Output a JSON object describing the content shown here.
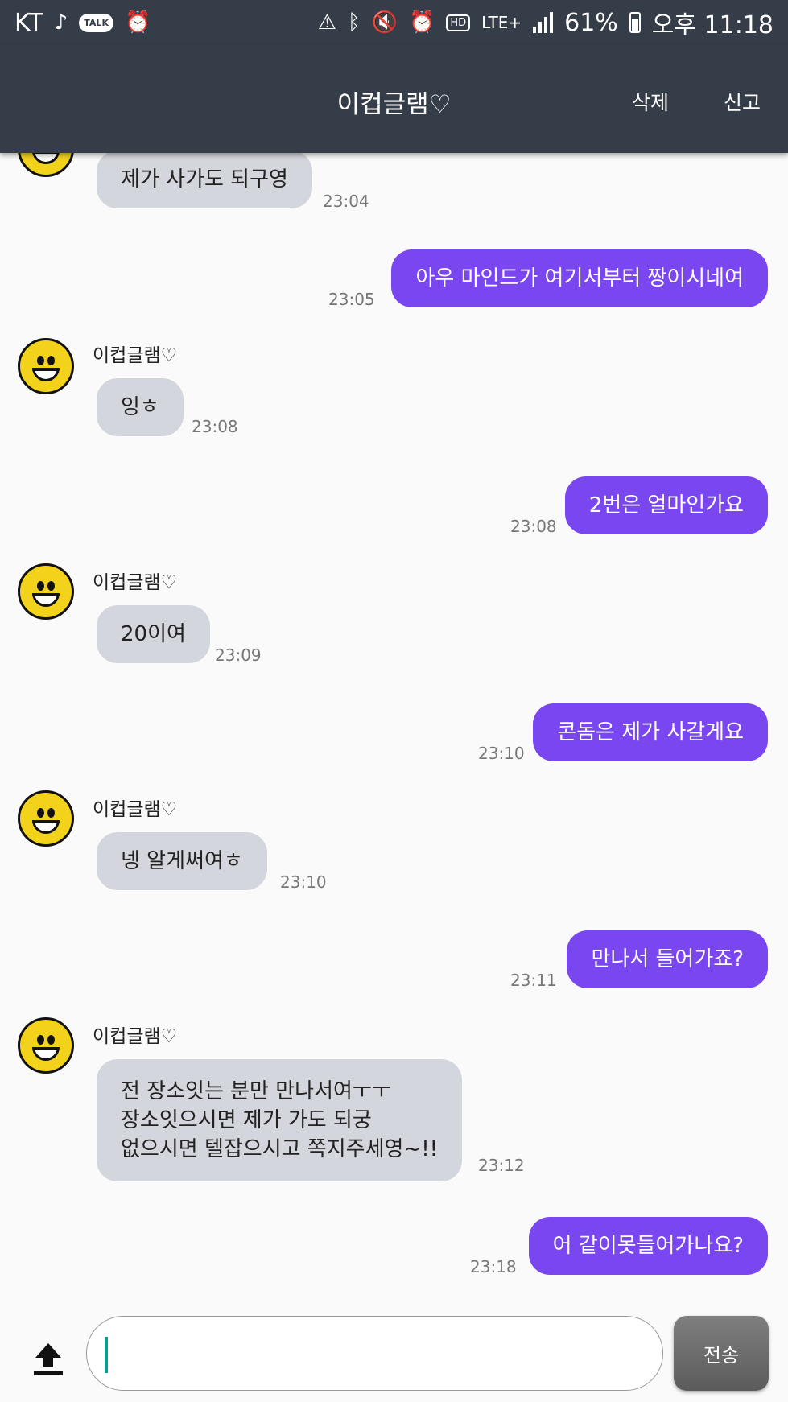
{
  "status_bar": {
    "carrier": "KT",
    "talk_badge": "TALK",
    "hd_badge": "HD",
    "network": "LTE+",
    "battery": "61%",
    "time": "오후 11:18",
    "icons": [
      "music-note-icon",
      "kakaotalk-icon",
      "alarm-icon",
      "nfc-icon",
      "bluetooth-icon",
      "mute-icon",
      "alarm-icon",
      "signal-icon",
      "battery-icon"
    ]
  },
  "header": {
    "title": "이컵글램♡",
    "delete_label": "삭제",
    "report_label": "신고"
  },
  "messages": [
    {
      "direction": "in",
      "text": "제가 사가도 되구영",
      "time": "23:04"
    },
    {
      "direction": "out",
      "text": "아우 마인드가 여기서부터 짱이시네여",
      "time": "23:05"
    },
    {
      "direction": "in",
      "sender": "이컵글램♡",
      "text": "잉ㅎ",
      "time": "23:08"
    },
    {
      "direction": "out",
      "text": "2번은 얼마인가요",
      "time": "23:08"
    },
    {
      "direction": "in",
      "sender": "이컵글램♡",
      "text": "20이여",
      "time": "23:09"
    },
    {
      "direction": "out",
      "text": "콘돔은 제가 사갈게요",
      "time": "23:10"
    },
    {
      "direction": "in",
      "sender": "이컵글램♡",
      "text": "넹 알게써여ㅎ",
      "time": "23:10"
    },
    {
      "direction": "out",
      "text": "만나서 들어가죠?",
      "time": "23:11"
    },
    {
      "direction": "in",
      "sender": "이컵글램♡",
      "text": "전 장소잇는 분만 만나서여ㅜㅜ\n장소잇으시면 제가 가도 되궁\n없으시면 텔잡으시고 쪽지주세영~!!",
      "time": "23:12"
    },
    {
      "direction": "out",
      "text": "어 같이못들어가나요?",
      "time": "23:18"
    }
  ],
  "composer": {
    "input_value": "",
    "send_label": "전송"
  }
}
